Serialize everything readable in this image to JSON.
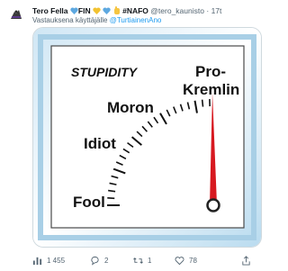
{
  "tweet": {
    "author_name": "Tero Fella",
    "author_tags": "FIN",
    "hashtag": "#NAFO",
    "handle": "@tero_kaunisto",
    "time": "17t",
    "reply_prefix": "Vastauksena käyttäjälle",
    "reply_to": "@TurtiainenAno"
  },
  "gauge": {
    "title": "STUPIDITY",
    "levels": [
      "Fool",
      "Idiot",
      "Moron",
      "Pro-",
      "Kremlin"
    ]
  },
  "actions": {
    "views": "1 455",
    "replies": "2",
    "retweets": "1",
    "likes": "78"
  },
  "colors": {
    "link": "#1d9bf0",
    "needle": "#d71920",
    "frame": "#a8cfe6",
    "muted": "#536471"
  }
}
